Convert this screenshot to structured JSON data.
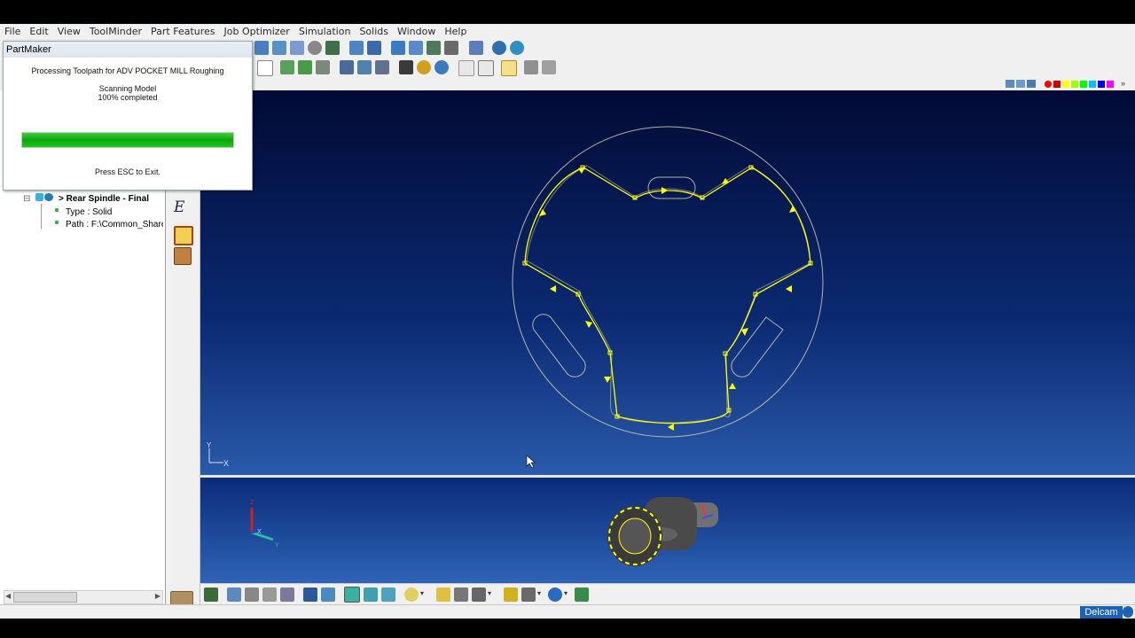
{
  "menu": [
    "File",
    "Edit",
    "View",
    "ToolMinder",
    "Part Features",
    "Job Optimizer",
    "Simulation",
    "Solids",
    "Window",
    "Help"
  ],
  "dialog": {
    "title": "PartMaker",
    "message": "Processing Toolpath for ADV POCKET MILL Roughing",
    "step": "Scanning Model",
    "percent_text": "100% completed",
    "progress": 1.0,
    "hint": "Press ESC to Exit."
  },
  "tree": {
    "item_label": "> Rear Spindle - Final",
    "type_label": "Type : Solid",
    "path_label": "Path : F:\\Common_Share"
  },
  "axes": {
    "x": "X",
    "y": "Y"
  },
  "statusbar": {
    "brand": "Delcam"
  },
  "colors": {
    "toolpath": "#ffff00",
    "geometry": "#c8c8a0",
    "accent": "#1c62b8",
    "progress": "#12b812"
  },
  "palette": [
    "#ff0000",
    "#d00000",
    "#ffff00",
    "#a0ff00",
    "#00ff00",
    "#00c0ff",
    "#0000ff",
    "#ff00ff"
  ]
}
